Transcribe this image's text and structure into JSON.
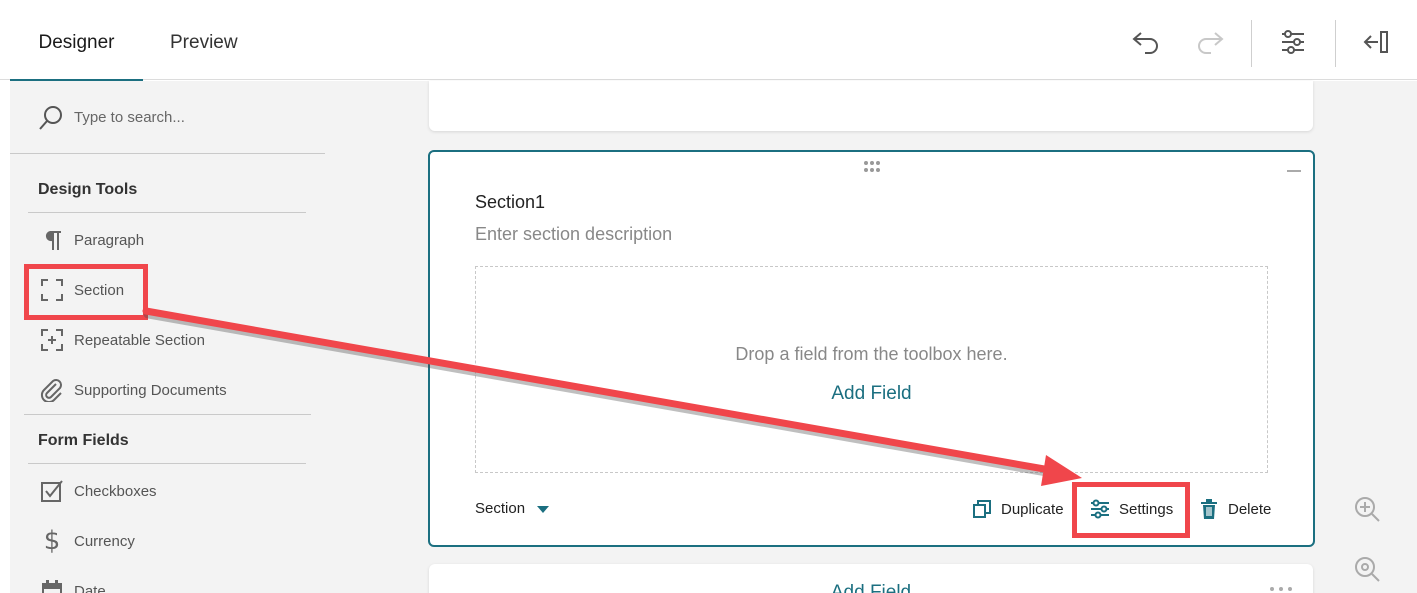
{
  "tabs": {
    "designer": "Designer",
    "preview": "Preview"
  },
  "toolbar": {
    "undo_icon": "undo-icon",
    "redo_icon": "redo-icon",
    "settings_icon": "sliders-icon",
    "collapse_icon": "collapse-panel-icon"
  },
  "sidebar": {
    "search_placeholder": "Type to search...",
    "groups": {
      "design_tools": "Design Tools",
      "form_fields": "Form Fields"
    },
    "design_tools": [
      {
        "label": "Paragraph",
        "icon": "paragraph-icon"
      },
      {
        "label": "Section",
        "icon": "section-icon"
      },
      {
        "label": "Repeatable Section",
        "icon": "repeatable-section-icon"
      },
      {
        "label": "Supporting Documents",
        "icon": "paperclip-icon"
      }
    ],
    "form_fields": [
      {
        "label": "Checkboxes",
        "icon": "checkbox-icon"
      },
      {
        "label": "Currency",
        "icon": "dollar-icon"
      },
      {
        "label": "Date",
        "icon": "calendar-icon"
      }
    ]
  },
  "section": {
    "title": "Section1",
    "description_placeholder": "Enter section description",
    "drop_text": "Drop a field from the toolbox here.",
    "add_field": "Add Field",
    "type_label": "Section",
    "actions": {
      "duplicate": "Duplicate",
      "settings": "Settings",
      "delete": "Delete"
    }
  },
  "next_card": {
    "add_field": "Add Field"
  },
  "colors": {
    "accent": "#1b6f80",
    "highlight": "#f0464b",
    "panel_bg": "#f3f3f3"
  }
}
